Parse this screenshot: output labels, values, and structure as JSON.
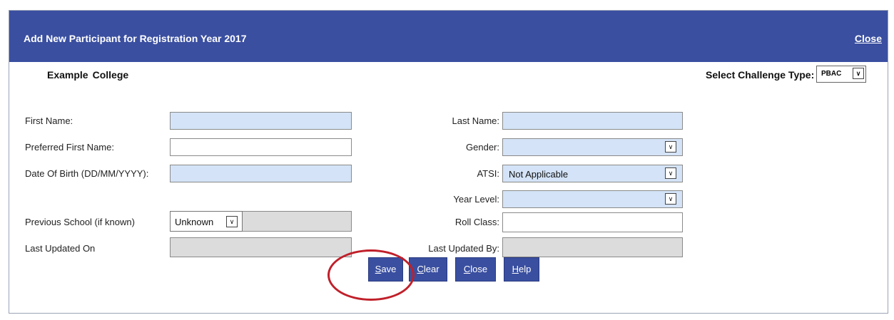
{
  "dialog": {
    "title": "Add New Participant for Registration Year 2017",
    "close_link": "Close"
  },
  "school": {
    "name_part1": "Example",
    "name_part2": "College"
  },
  "challenge": {
    "label": "Select Challenge Type:",
    "value": "PBAC"
  },
  "form": {
    "first_name": {
      "label": "First Name:",
      "value": ""
    },
    "preferred_first_name": {
      "label": "Preferred First Name:",
      "value": ""
    },
    "date_of_birth": {
      "label": "Date Of Birth (DD/MM/YYYY):",
      "value": ""
    },
    "previous_school": {
      "label": "Previous School (if known)",
      "value": "Unknown"
    },
    "last_updated_on": {
      "label": "Last Updated On",
      "value": ""
    },
    "last_name": {
      "label": "Last Name:",
      "value": ""
    },
    "gender": {
      "label": "Gender:",
      "value": ""
    },
    "atsi": {
      "label": "ATSI:",
      "value": "Not Applicable"
    },
    "year_level": {
      "label": "Year Level:",
      "value": ""
    },
    "roll_class": {
      "label": "Roll Class:",
      "value": ""
    },
    "last_updated_by": {
      "label": "Last Updated By:",
      "value": ""
    }
  },
  "buttons": {
    "save": {
      "mnemonic": "S",
      "rest": "ave"
    },
    "clear": {
      "mnemonic": "C",
      "rest": "lear"
    },
    "close": {
      "mnemonic": "C",
      "rest": "lose"
    },
    "help": {
      "mnemonic": "H",
      "rest": "elp"
    }
  },
  "colors": {
    "header": "#3a4fa0",
    "field_blue": "#d4e3f7",
    "field_grey": "#dcdcdc",
    "highlight_circle": "#c0202a"
  },
  "icons": {
    "dropdown": "chevron-down-icon"
  }
}
